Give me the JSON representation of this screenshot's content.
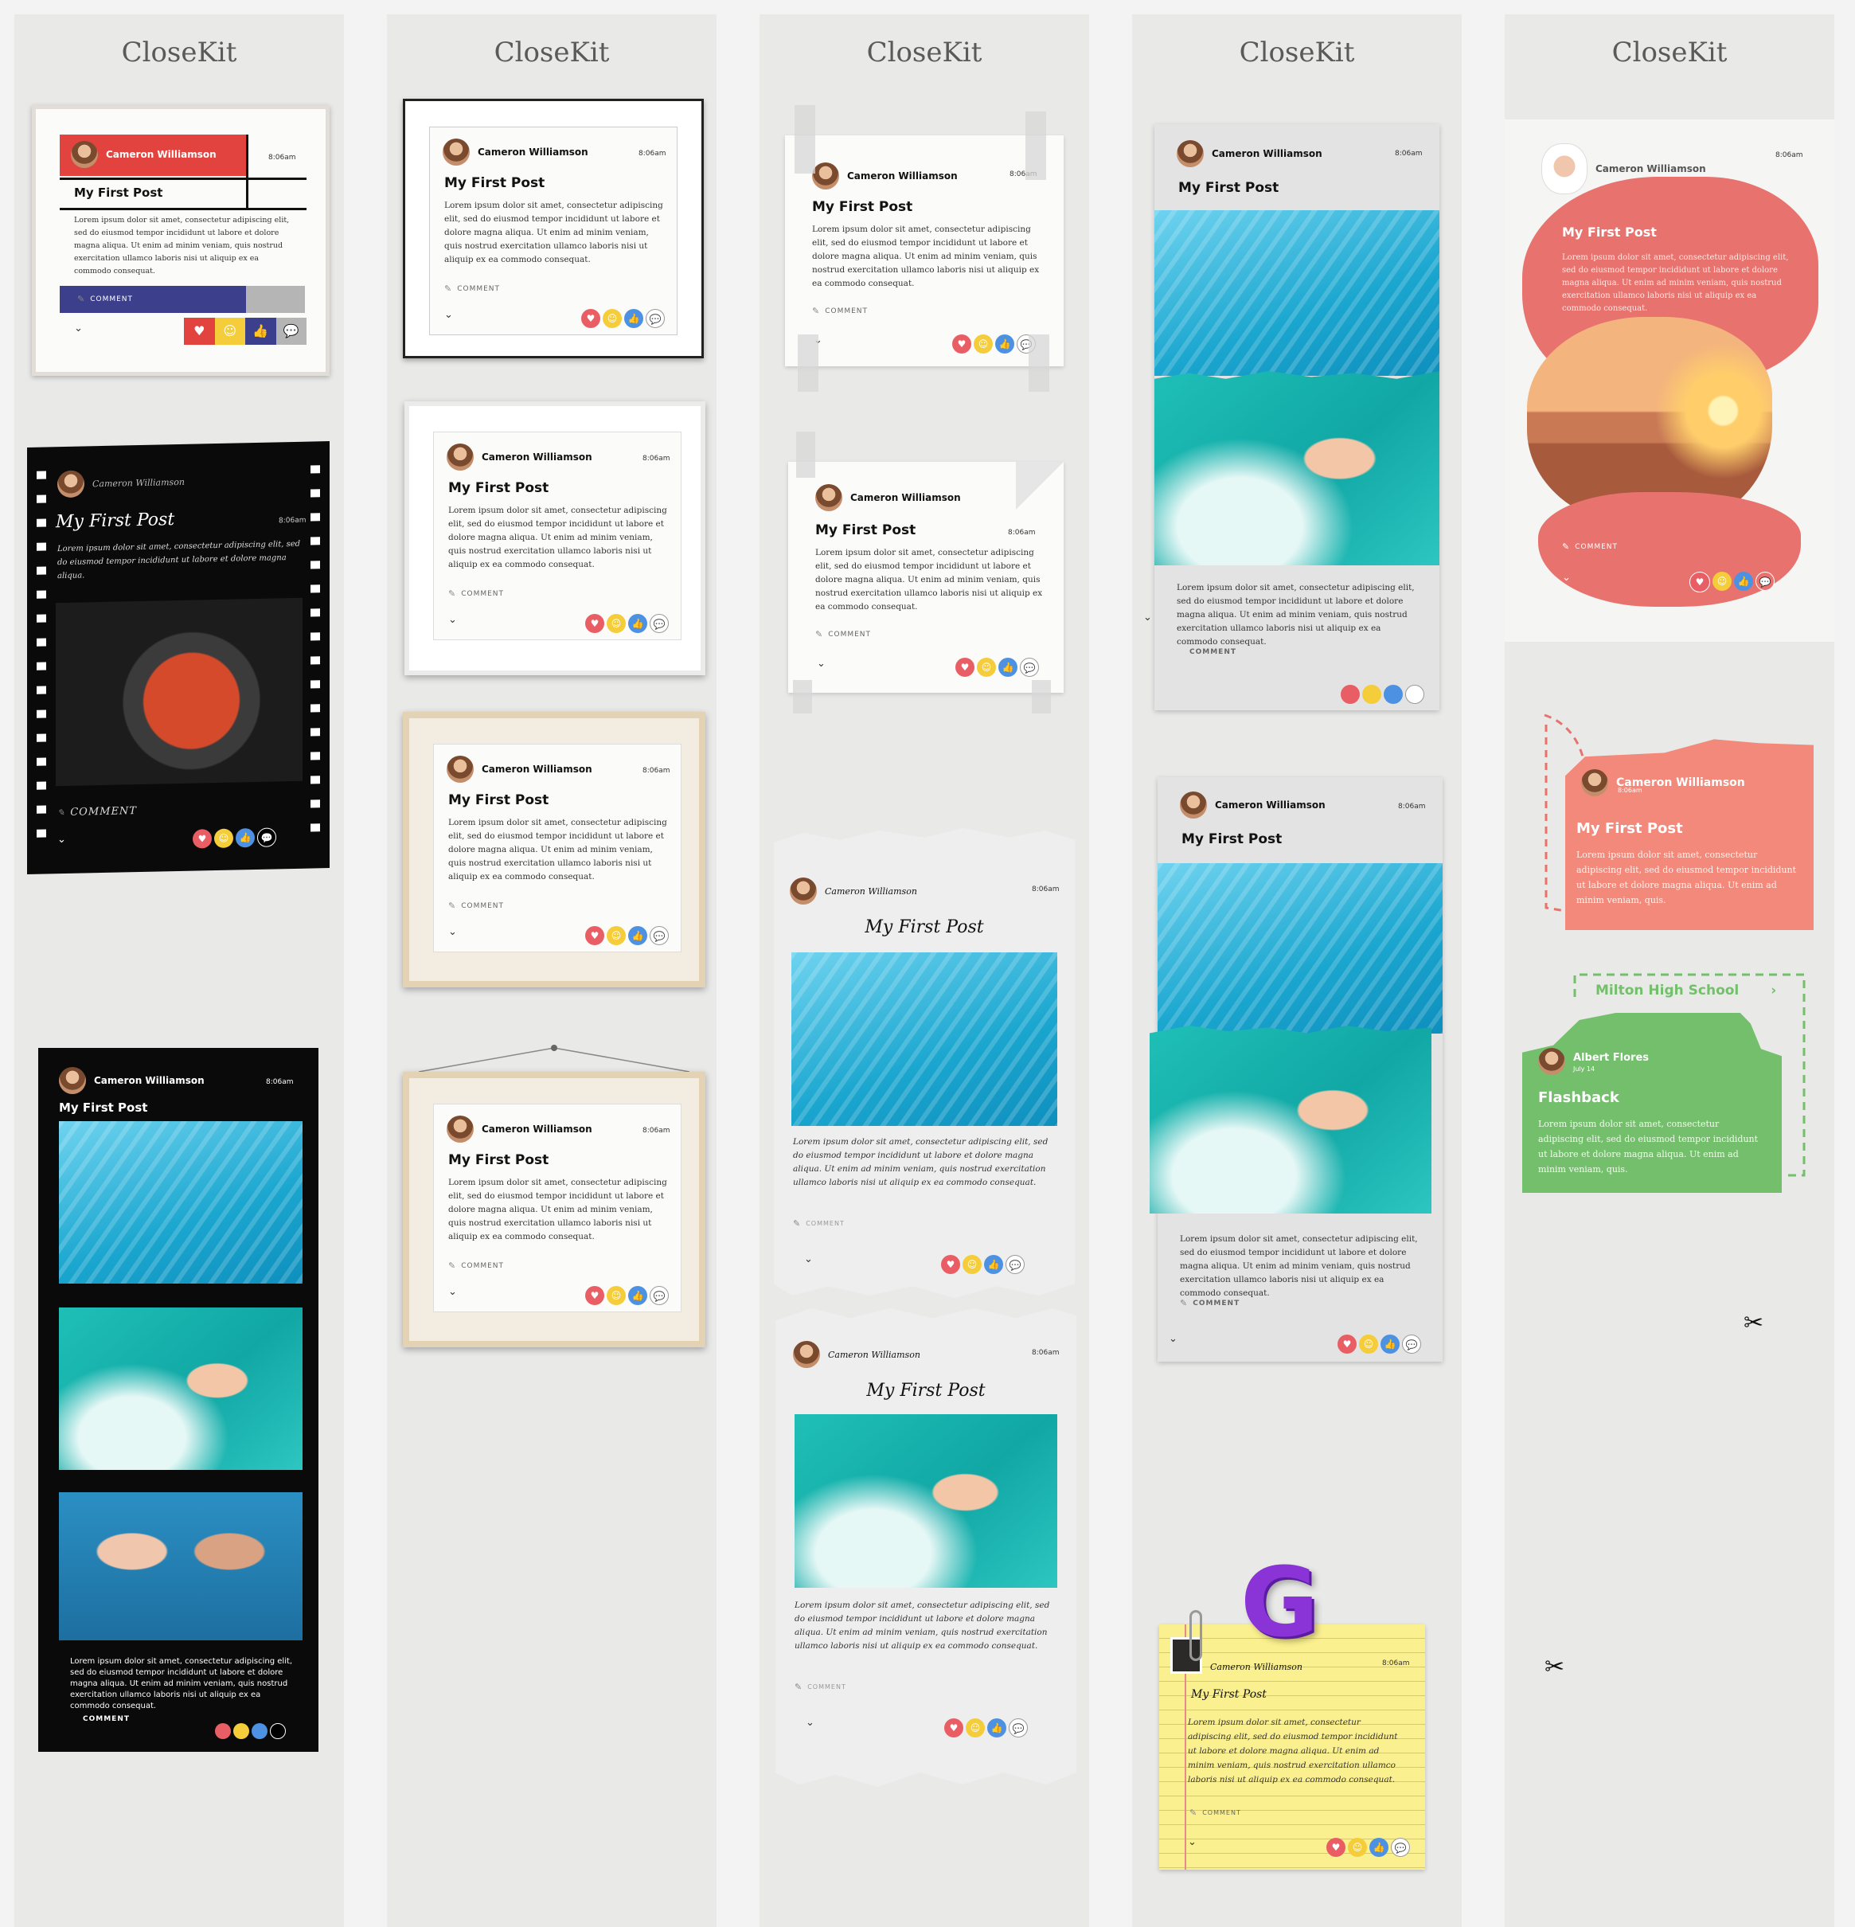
{
  "brand": "CloseKit",
  "user": "Cameron Williamson",
  "time": "8:06am",
  "post_title": "My First Post",
  "body_long": "Lorem ipsum dolor sit amet, consectetur adipiscing elit, sed do eiusmod tempor incididunt ut labore et dolore magna aliqua. Ut enim ad minim veniam, quis nostrud exercitation ullamco laboris nisi ut aliquip ex ea commodo consequat.",
  "body_short": "Lorem ipsum dolor sit amet, consectetur adipiscing elit, sed do eiusmod tempor incididunt ut labore et dolore magna aliqua.",
  "body_mid": "Lorem ipsum dolor sit amet, consectetur adipiscing elit, sed do eiusmod tempor incididunt ut labore et dolore magna aliqua. Ut enim ad minim veniam, quis.",
  "comment": "COMMENT",
  "comment_lower": "COMMENT",
  "school": "Milton High School",
  "albert": {
    "name": "Albert Flores",
    "date": "July 14",
    "title": "Flashback"
  },
  "letter_g": "G",
  "colors": {
    "red": "#e85e64",
    "yellow": "#f5cd3a",
    "blue": "#4d91e2",
    "coral": "#e8726d",
    "salmon": "#f2897a",
    "green": "#74bf6c",
    "navy": "#3c3f8c"
  }
}
